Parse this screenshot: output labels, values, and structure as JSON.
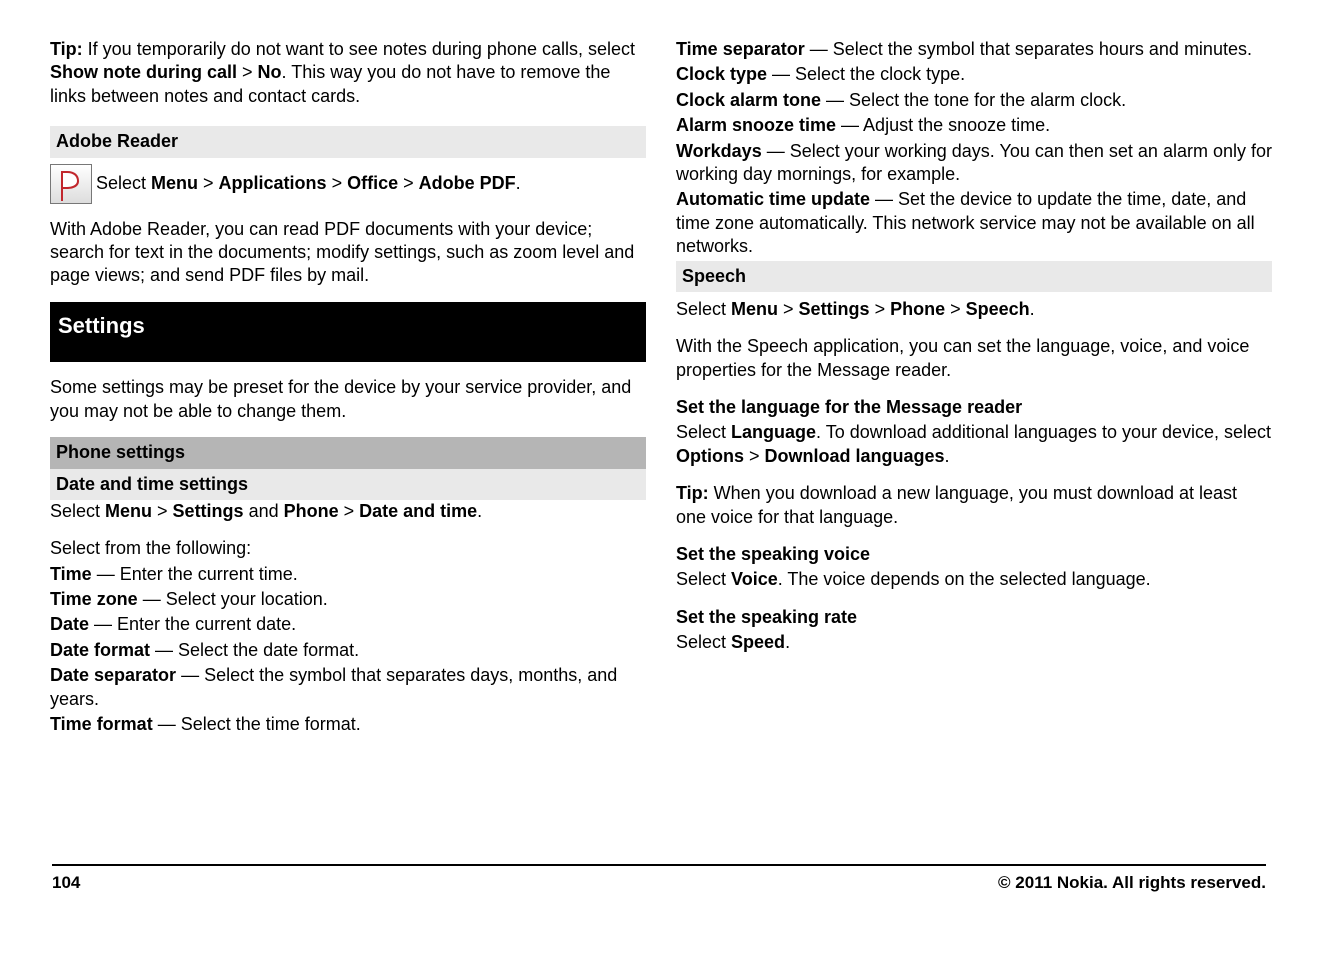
{
  "left": {
    "tip_label": "Tip:",
    "tip_text_a": " If you temporarily do not want to see notes during phone calls, select ",
    "tip_bold_a": "Show note during call",
    "tip_gt": " > ",
    "tip_bold_b": "No",
    "tip_text_b": ". This way you do not have to remove the links between notes and contact cards.",
    "adobe_heading": "Adobe Reader",
    "adobe_select": "Select ",
    "adobe_menu": "Menu",
    "adobe_apps": "Applications",
    "adobe_office": "Office",
    "adobe_pdf": "Adobe PDF",
    "adobe_period": ".",
    "adobe_desc": "With Adobe Reader, you can read PDF documents with your device; search for text in the documents; modify settings, such as zoom level and page views; and send PDF files by mail.",
    "settings_heading": "Settings",
    "settings_intro": "Some settings may be preset for the device by your service provider, and you may not be able to change them.",
    "phone_settings_heading": "Phone settings",
    "date_time_heading": "Date and time settings",
    "dt_select": "Select ",
    "dt_menu": "Menu",
    "dt_settings": "Settings",
    "dt_and": " and ",
    "dt_phone": "Phone",
    "dt_datetime": "Date and time",
    "dt_period": ".",
    "select_following": "Select from the following:",
    "opts": [
      {
        "label": "Time",
        "desc": " — Enter the current time."
      },
      {
        "label": "Time zone",
        "desc": " — Select your location."
      },
      {
        "label": "Date",
        "desc": " — Enter the current date."
      },
      {
        "label": "Date format",
        "desc": " — Select the date format."
      },
      {
        "label": "Date separator",
        "desc": " — Select the symbol that separates days, months, and years."
      },
      {
        "label": "Time format",
        "desc": " — Select the time format."
      }
    ]
  },
  "right": {
    "opts": [
      {
        "label": "Time separator",
        "desc": " — Select the symbol that separates hours and minutes."
      },
      {
        "label": "Clock type",
        "desc": " — Select the clock type."
      },
      {
        "label": "Clock alarm tone",
        "desc": " — Select the tone for the alarm clock."
      },
      {
        "label": "Alarm snooze time",
        "desc": " — Adjust the snooze time."
      },
      {
        "label": "Workdays",
        "desc": " — Select your working days. You can then set an alarm only for working day mornings, for example."
      },
      {
        "label": "Automatic time update",
        "desc": " — Set the device to update the time, date, and time zone automatically. This network service may not be available on all networks."
      }
    ],
    "speech_heading": "Speech",
    "sp_select": "Select ",
    "sp_menu": "Menu",
    "sp_settings": "Settings",
    "sp_phone": "Phone",
    "sp_speech": "Speech",
    "sp_period": ".",
    "speech_desc": "With the Speech application, you can set the language, voice, and voice properties for the Message reader.",
    "set_lang_heading": "Set the language for the Message reader",
    "set_lang_select": "Select ",
    "set_lang_lang": "Language",
    "set_lang_text": ". To download additional languages to your device, select ",
    "set_lang_opts": "Options",
    "set_lang_dl": "Download languages",
    "set_lang_period": ".",
    "tip2_label": "Tip:",
    "tip2_text": " When you download a new language, you must download at least one voice for that language.",
    "voice_heading": "Set the speaking voice",
    "voice_select": "Select ",
    "voice_voice": "Voice",
    "voice_text": ". The voice depends on the selected language.",
    "rate_heading": "Set the speaking rate",
    "rate_select": "Select ",
    "rate_speed": "Speed",
    "rate_period": "."
  },
  "footer": {
    "page_num": "104",
    "copyright": "© 2011 Nokia. All rights reserved."
  }
}
